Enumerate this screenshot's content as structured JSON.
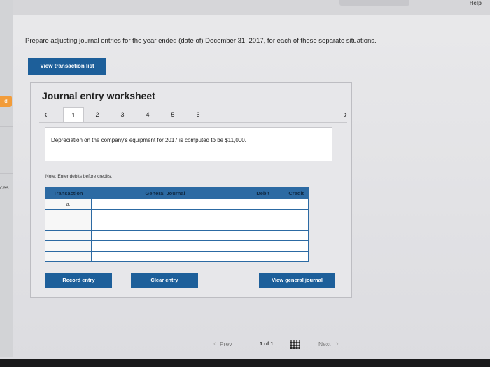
{
  "header": {
    "help_label": "Help"
  },
  "sidebar": {
    "tab_label": "d",
    "partial_text": "ces"
  },
  "instructions": "Prepare adjusting journal entries for the year ended (date of) December 31, 2017, for each of these separate situations.",
  "view_transaction_button": "View transaction list",
  "worksheet": {
    "title": "Journal entry worksheet",
    "tabs": [
      "1",
      "2",
      "3",
      "4",
      "5",
      "6"
    ],
    "active_tab": "1",
    "description": "Depreciation on the company's equipment for 2017 is computed to be $11,000.",
    "note": "Note: Enter debits before credits.",
    "table": {
      "headers": [
        "Transaction",
        "General Journal",
        "Debit",
        "Credit"
      ],
      "rows": [
        [
          "a.",
          "",
          "",
          ""
        ],
        [
          "",
          "",
          "",
          ""
        ],
        [
          "",
          "",
          "",
          ""
        ],
        [
          "",
          "",
          "",
          ""
        ],
        [
          "",
          "",
          "",
          ""
        ],
        [
          "",
          "",
          "",
          ""
        ]
      ]
    },
    "buttons": {
      "record": "Record entry",
      "clear": "Clear entry",
      "view_journal": "View general journal"
    }
  },
  "pager": {
    "prev": "Prev",
    "page": "1 of 1",
    "next": "Next"
  },
  "colors": {
    "primary": "#1d5f9a",
    "accent_tab": "#f29c3a"
  }
}
